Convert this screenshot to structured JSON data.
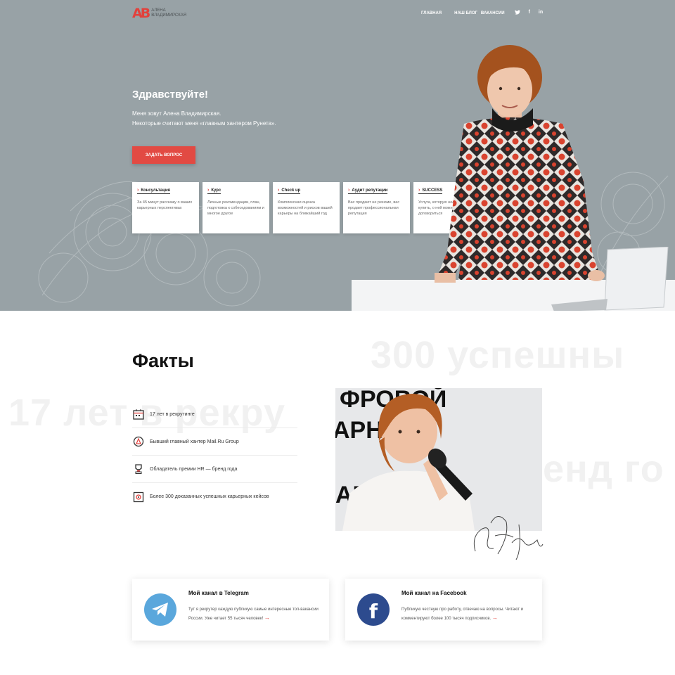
{
  "logo": {
    "mark": "АВ",
    "line1": "Алена",
    "line2": "Владимирская"
  },
  "nav": {
    "items": [
      "главная",
      "наш блог",
      "вакансии"
    ],
    "social": [
      "twitter-icon",
      "facebook-icon",
      "linkedin-icon"
    ]
  },
  "hero": {
    "title": "Здравствуйте!",
    "intro_line1": "Меня зовут Алена Владимирская.",
    "intro_line2": "Некоторые считают меня «главным хантером Рунета».",
    "ask_button": "задать вопрос"
  },
  "services": [
    {
      "title": "Консультация",
      "text": "За 45 минут расскажу о ваших карьерных перспективах"
    },
    {
      "title": "Курс",
      "text": "Личные рекомендации, план, подготовка к собеседованиям и многое другое"
    },
    {
      "title": "Check up",
      "text": "Комплексная оценка возможностей и рисков вашей карьеры на ближайший год"
    },
    {
      "title": "Аудит репутации",
      "text": "Вас продают не резюме, вас продает профессиональная репутация"
    },
    {
      "title": "SUCCESS",
      "text": "Услуга, которую нельзя просто купить, о ней можно с нами договориться"
    }
  ],
  "facts": {
    "title": "Факты",
    "bg_text_1": "300 успешны",
    "bg_text_2": "17 лет в рекру",
    "bg_text_3": "енд го",
    "items": [
      {
        "icon": "calendar-icon",
        "text": "17 лет в рекрутинге"
      },
      {
        "icon": "mail-ru-icon",
        "text": "Бывший главный хантер Mail.Ru Group"
      },
      {
        "icon": "trophy-icon",
        "text": "Обладатель премии HR — бренд года"
      },
      {
        "icon": "badge-icon",
        "text": "Более 300 доказанных успешных карьерных кейсов"
      }
    ],
    "photo_words": [
      "ФРОВОЙ",
      "АРНЫЙ",
      "АРФА"
    ]
  },
  "channels": {
    "telegram": {
      "title": "Мой канал в Telegram",
      "text": "Тут я рекрутер каждую публикую самые интересные топ-вакансии России. Уже читает 55 тысяч человек!",
      "color": "#5aa7dc"
    },
    "facebook": {
      "title": "Мой канал на Facebook",
      "text": "Публикую честную про работу, отвечаю на вопросы. Читают и комментируют более 100 тысяч подписчиков.",
      "color": "#2d4b8e"
    }
  }
}
